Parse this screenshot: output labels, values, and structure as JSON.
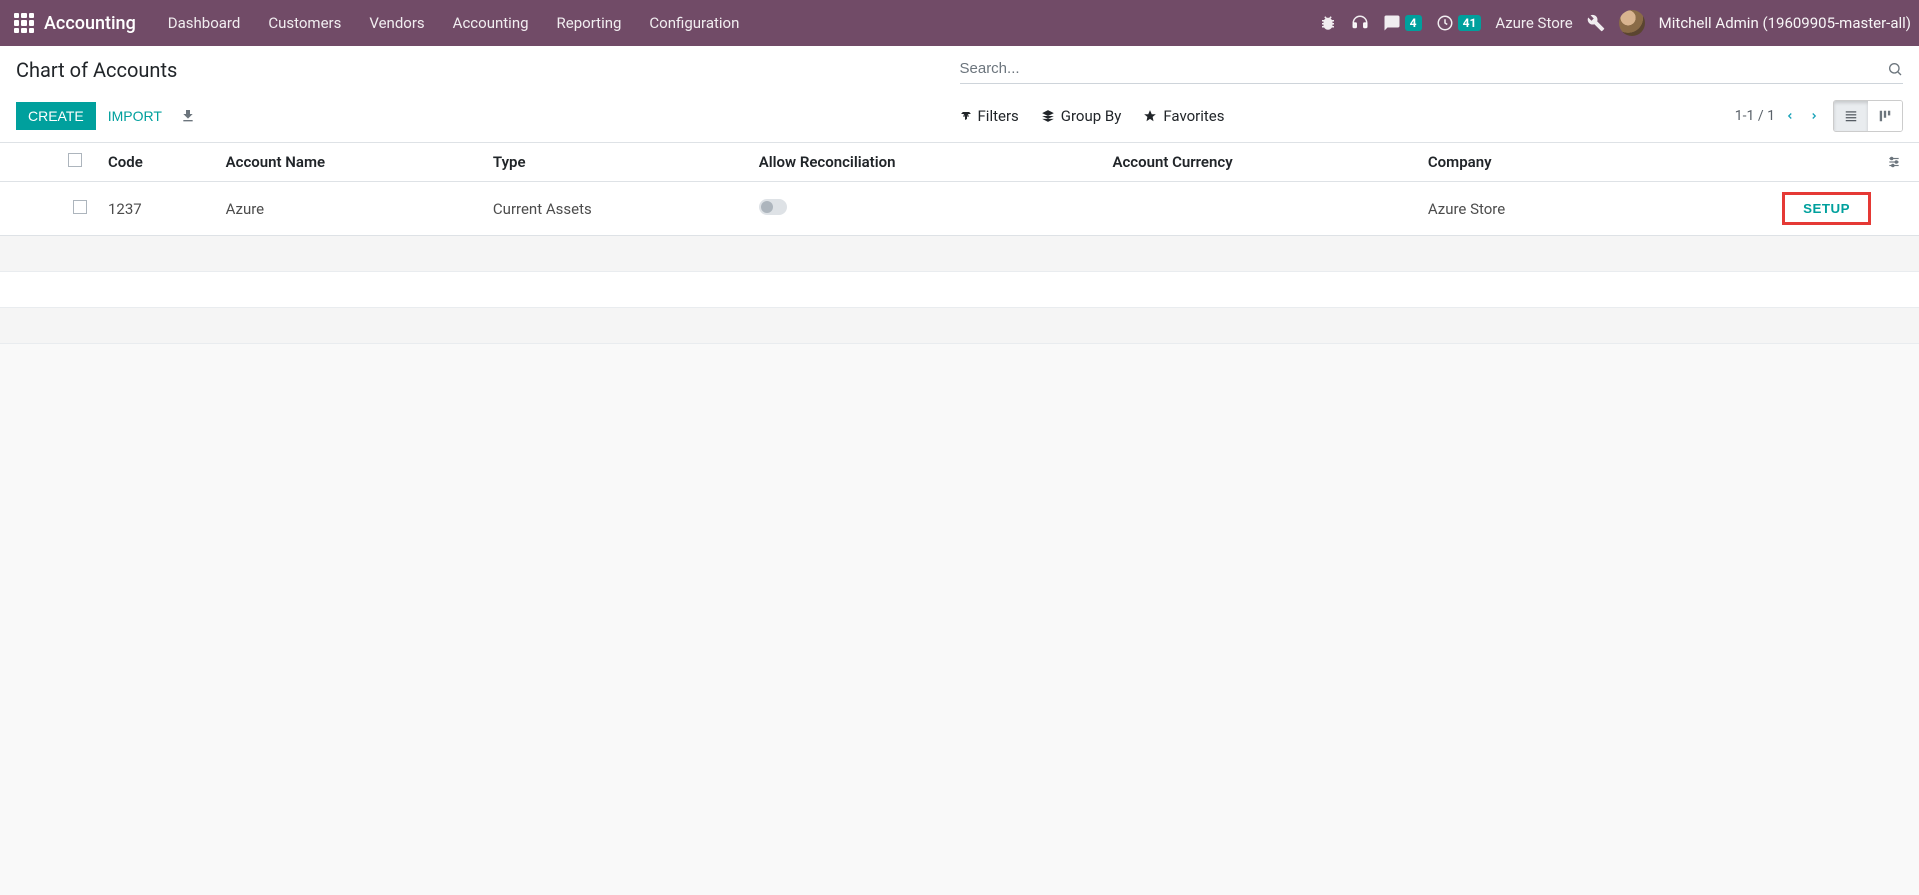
{
  "navbar": {
    "brand": "Accounting",
    "menu": [
      "Dashboard",
      "Customers",
      "Vendors",
      "Accounting",
      "Reporting",
      "Configuration"
    ],
    "messages_badge": "4",
    "activities_badge": "41",
    "company": "Azure Store",
    "user": "Mitchell Admin (19609905-master-all)"
  },
  "control_panel": {
    "breadcrumb": "Chart of Accounts",
    "search_placeholder": "Search...",
    "create_label": "Create",
    "import_label": "Import",
    "filters_label": "Filters",
    "groupby_label": "Group By",
    "favorites_label": "Favorites",
    "pager": "1-1 / 1"
  },
  "table": {
    "headers": {
      "code": "Code",
      "account_name": "Account Name",
      "type": "Type",
      "allow_reconciliation": "Allow Reconciliation",
      "account_currency": "Account Currency",
      "company": "Company"
    },
    "rows": [
      {
        "code": "1237",
        "account_name": "Azure",
        "type": "Current Assets",
        "allow_reconciliation": false,
        "account_currency": "",
        "company": "Azure Store",
        "setup_label": "SETUP"
      }
    ]
  }
}
